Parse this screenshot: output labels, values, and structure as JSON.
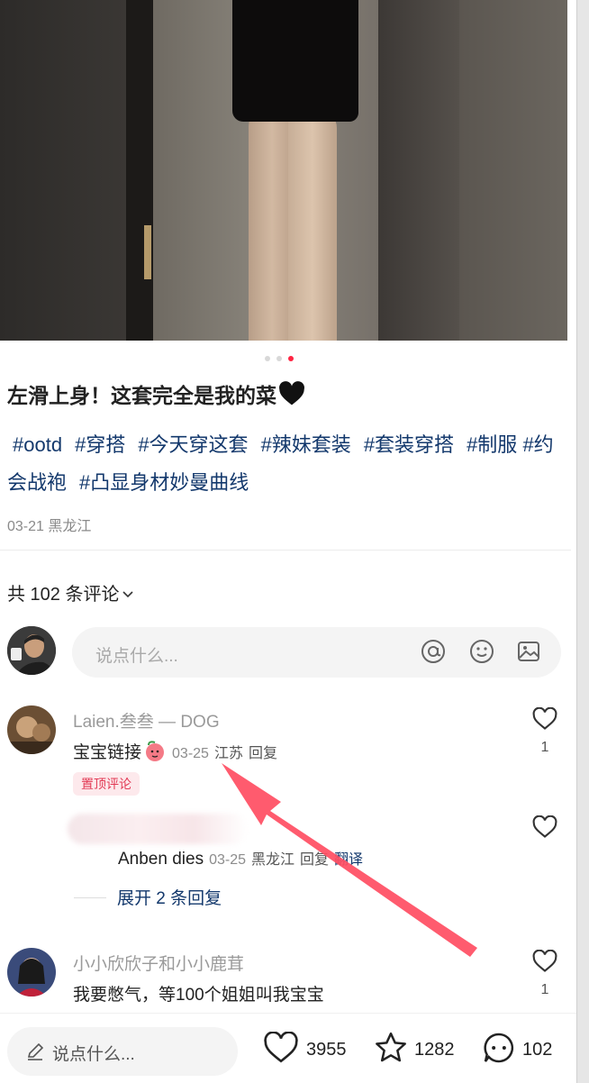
{
  "post": {
    "title": "左滑上身！这套完全是我的菜",
    "tags": [
      "#ootd",
      "#穿搭",
      "#今天穿这套",
      "#辣妹套装",
      "#套装穿搭",
      "#制服",
      "#约会战袍",
      "#凸显身材妙曼曲线"
    ],
    "date": "03-21",
    "location": "黑龙江",
    "carousel": {
      "total": 3,
      "active": 3
    }
  },
  "comments_header": {
    "label": "共 102 条评论",
    "chevron": "chevron-down-icon"
  },
  "comment_input": {
    "placeholder": "说点什么...",
    "icons": [
      "at-icon",
      "emoji-icon",
      "image-icon"
    ]
  },
  "comments": [
    {
      "author": "Laien.叁叁 — DOG",
      "text": "宝宝链接",
      "emoji": "peach-sticker-icon",
      "date": "03-25",
      "location": "江苏",
      "reply_label": "回复",
      "badge": "置顶评论",
      "likes": "1",
      "replies": [
        {
          "author": "",
          "text": "Anben dies",
          "date": "03-25",
          "location": "黑龙江",
          "reply_label": "回复",
          "translate_label": "翻译"
        }
      ],
      "expand_label": "展开 2 条回复"
    },
    {
      "author": "小小欣欣子和小小鹿茸",
      "text": "我要憋气，等100个姐姐叫我宝宝",
      "likes": "1"
    }
  ],
  "bottom_bar": {
    "placeholder": "说点什么...",
    "likes": "3955",
    "favorites": "1282",
    "comments": "102"
  },
  "colors": {
    "accent": "#e23a55",
    "tag": "#13386c",
    "arrow": "#ff4d62"
  }
}
